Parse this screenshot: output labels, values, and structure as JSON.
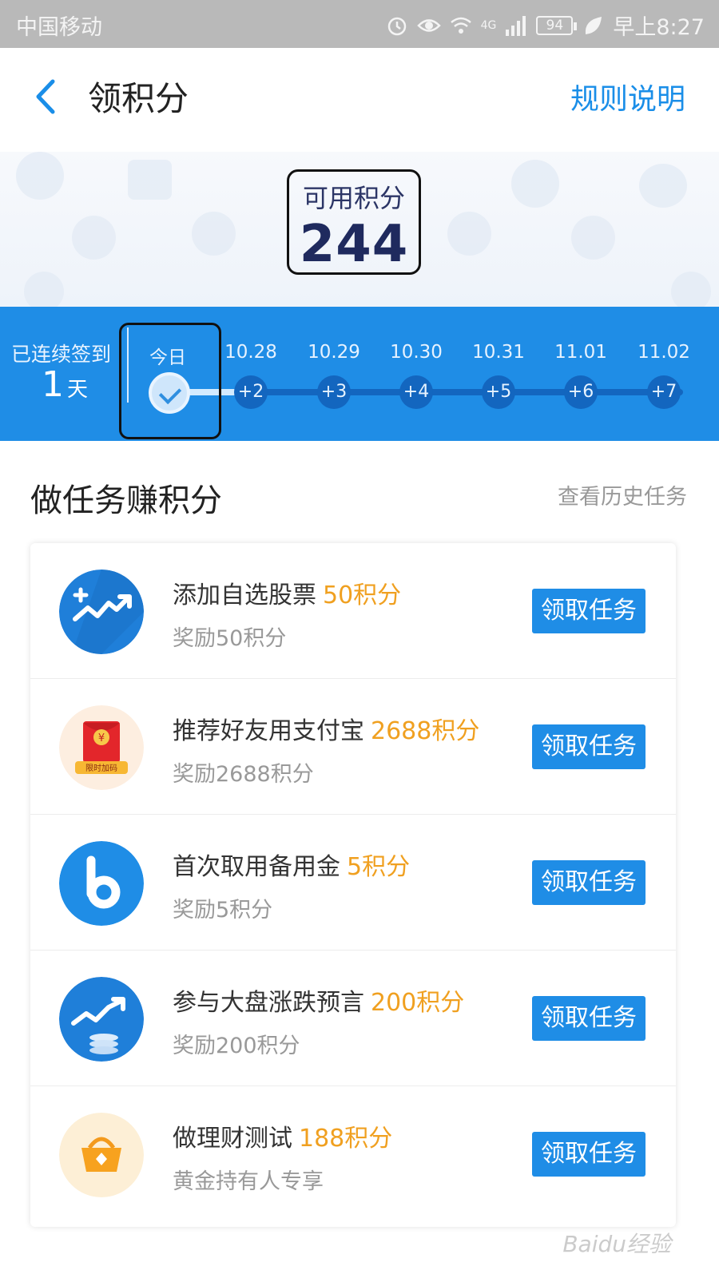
{
  "status_bar": {
    "carrier": "中国移动",
    "network": "4G",
    "battery": "94",
    "time": "早上8:27"
  },
  "header": {
    "title": "领积分",
    "rules_link": "规则说明"
  },
  "points": {
    "label": "可用积分",
    "value": "244"
  },
  "checkin": {
    "streak_label": "已连续签到",
    "streak_count": "1",
    "streak_unit": "天",
    "today_label": "今日",
    "days": [
      {
        "date": "10.28",
        "reward": "+2"
      },
      {
        "date": "10.29",
        "reward": "+3"
      },
      {
        "date": "10.30",
        "reward": "+4"
      },
      {
        "date": "10.31",
        "reward": "+5"
      },
      {
        "date": "11.01",
        "reward": "+6"
      },
      {
        "date": "11.02",
        "reward": "+7"
      }
    ]
  },
  "tasks_section": {
    "title": "做任务赚积分",
    "history_link": "查看历史任务"
  },
  "tasks": [
    {
      "icon": "stock-chart-icon",
      "title": "添加自选股票",
      "points": "50积分",
      "subtitle": "奖励50积分",
      "button": "领取任务"
    },
    {
      "icon": "red-envelope-icon",
      "title": "推荐好友用支付宝",
      "points": "2688积分",
      "subtitle": "奖励2688积分",
      "button": "领取任务"
    },
    {
      "icon": "letter-b-icon",
      "title": "首次取用备用金",
      "points": "5积分",
      "subtitle": "奖励5积分",
      "button": "领取任务"
    },
    {
      "icon": "market-trend-icon",
      "title": "参与大盘涨跌预言",
      "points": "200积分",
      "subtitle": "奖励200积分",
      "button": "领取任务"
    },
    {
      "icon": "gold-basket-icon",
      "title": "做理财测试",
      "points": "188积分",
      "subtitle": "黄金持有人专享",
      "button": "领取任务"
    }
  ],
  "icon_badges": {
    "red_envelope_caption": "限时加码",
    "yuan_symbol": "¥"
  },
  "watermark": "Baidu经验",
  "colors": {
    "accent": "#1f8de6",
    "points_highlight": "#f0a020",
    "status_bar": "#b9b9b9"
  }
}
